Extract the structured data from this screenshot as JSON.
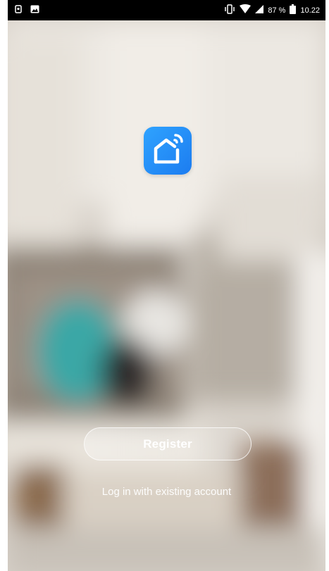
{
  "status_bar": {
    "battery_percent": "87 %",
    "time": "10.22",
    "icons": [
      "sim-icon",
      "image-icon",
      "vibrate-icon",
      "wifi-icon",
      "signal-icon",
      "battery-icon"
    ]
  },
  "welcome": {
    "logo_icon": "smart-home-icon",
    "register_label": "Register",
    "login_link_label": "Log in with existing account"
  },
  "colors": {
    "logo_gradient_start": "#2fa3ff",
    "logo_gradient_end": "#1c7cf0",
    "button_text": "#ffffff"
  }
}
